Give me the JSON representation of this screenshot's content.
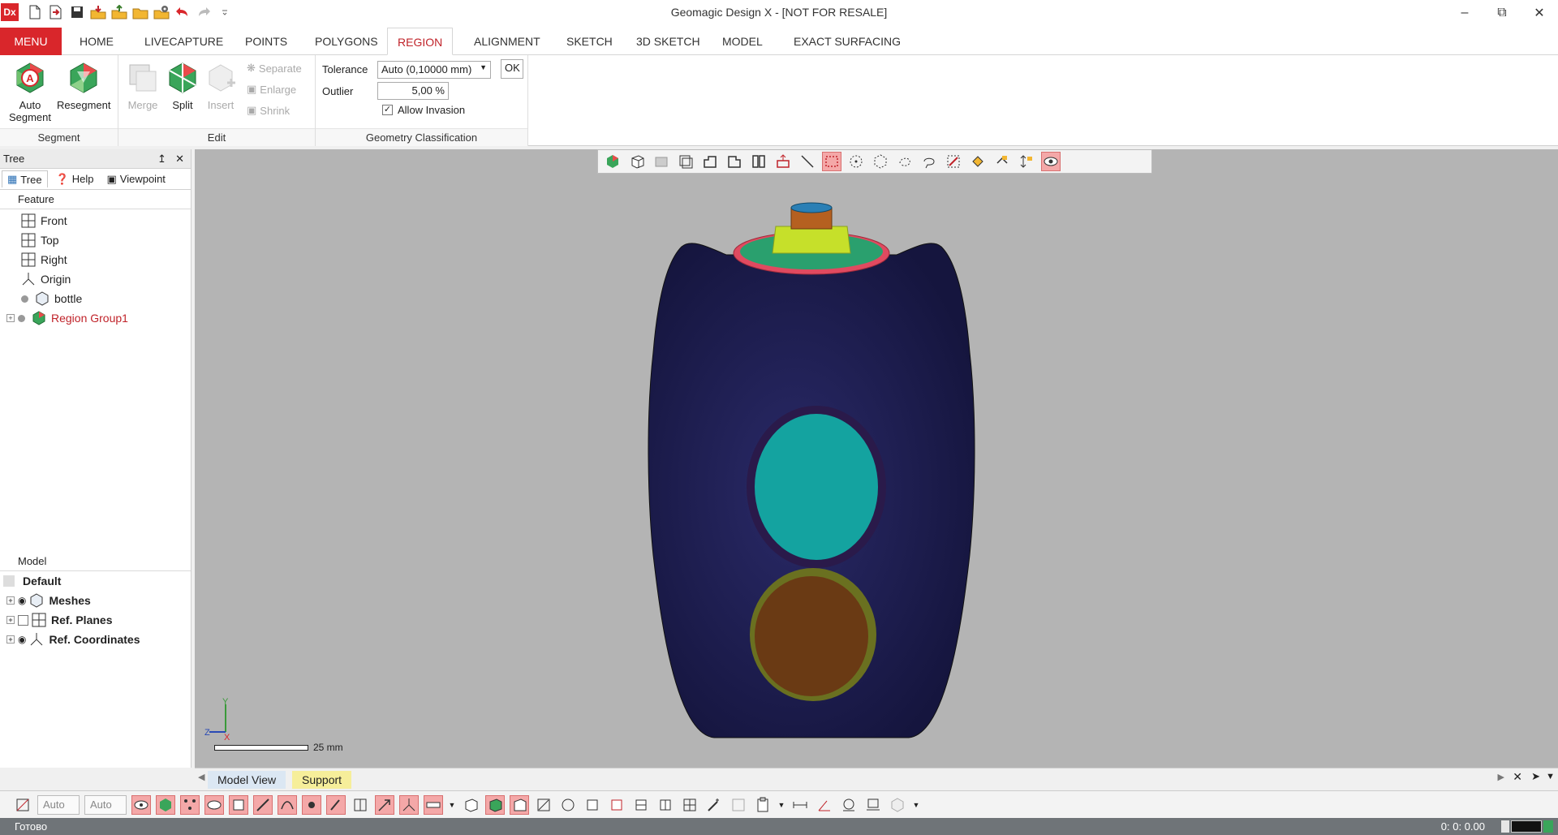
{
  "app": {
    "icon_label": "Dx",
    "title": "Geomagic Design X - [NOT FOR RESALE]"
  },
  "quick_access": [
    "new-file-icon",
    "open-file-icon",
    "save-icon",
    "import-icon",
    "export-icon",
    "open-folder-icon",
    "options-icon",
    "undo-icon",
    "redo-icon",
    "customize-icon"
  ],
  "tabs": [
    {
      "label": "MENU"
    },
    {
      "label": "HOME"
    },
    {
      "label": "LIVECAPTURE"
    },
    {
      "label": "POINTS"
    },
    {
      "label": "POLYGONS"
    },
    {
      "label": "REGION"
    },
    {
      "label": "ALIGNMENT"
    },
    {
      "label": "SKETCH"
    },
    {
      "label": "3D SKETCH"
    },
    {
      "label": "MODEL"
    },
    {
      "label": "EXACT SURFACING"
    }
  ],
  "ribbon": {
    "segment": {
      "label": "Segment",
      "auto_segment": "Auto\nSegment",
      "auto_segment_l1": "Auto",
      "auto_segment_l2": "Segment",
      "resegment": "Resegment"
    },
    "edit": {
      "label": "Edit",
      "merge": "Merge",
      "split": "Split",
      "insert": "Insert",
      "separate": "Separate",
      "enlarge": "Enlarge",
      "shrink": "Shrink"
    },
    "geometry": {
      "label": "Geometry Classification",
      "tolerance_label": "Tolerance",
      "tolerance_value": "Auto (0,10000 mm)",
      "ok": "OK",
      "outlier_label": "Outlier",
      "outlier_value": "5,00 %",
      "allow_invasion": "Allow Invasion",
      "allow_invasion_checked": true
    }
  },
  "tree_panel": {
    "title": "Tree",
    "tabs": [
      "Tree",
      "Help",
      "Viewpoint"
    ],
    "feature_label": "Feature",
    "features": [
      {
        "label": "Front",
        "icon": "plane-icon"
      },
      {
        "label": "Top",
        "icon": "plane-icon"
      },
      {
        "label": "Right",
        "icon": "plane-icon"
      },
      {
        "label": "Origin",
        "icon": "coordinate-icon"
      },
      {
        "label": "bottle",
        "icon": "mesh-icon"
      },
      {
        "label": "Region Group1",
        "icon": "region-group-icon"
      }
    ],
    "model_label": "Model",
    "model_items": [
      {
        "label": "Default"
      },
      {
        "label": "Meshes"
      },
      {
        "label": "Ref. Planes"
      },
      {
        "label": "Ref. Coordinates"
      }
    ]
  },
  "viewport": {
    "scale_label": "25 mm",
    "axis_y": "Y",
    "axis_z": "Z",
    "axis_x": "X"
  },
  "view_tabs": [
    "Model View",
    "Support"
  ],
  "bottom_toolbar": {
    "combo1": "Auto",
    "combo2": "Auto"
  },
  "status": {
    "text": "Готово",
    "time": "0: 0: 0.00"
  }
}
